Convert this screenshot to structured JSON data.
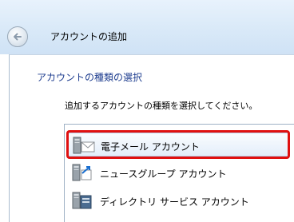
{
  "window": {
    "title": "アカウントの追加",
    "back_icon": "back-arrow-icon"
  },
  "main": {
    "heading": "アカウントの種類の選択",
    "instruction": "追加するアカウントの種類を選択してください。"
  },
  "account_types": [
    {
      "label": "電子メール アカウント",
      "icon": "email-account-icon",
      "selected": true
    },
    {
      "label": "ニュースグループ アカウント",
      "icon": "newsgroup-account-icon",
      "selected": false
    },
    {
      "label": "ディレクトリ サービス アカウント",
      "icon": "directory-service-icon",
      "selected": false
    }
  ],
  "colors": {
    "heading": "#1e3d8f",
    "highlight": "#e01010",
    "selection": "#e3eefa"
  }
}
